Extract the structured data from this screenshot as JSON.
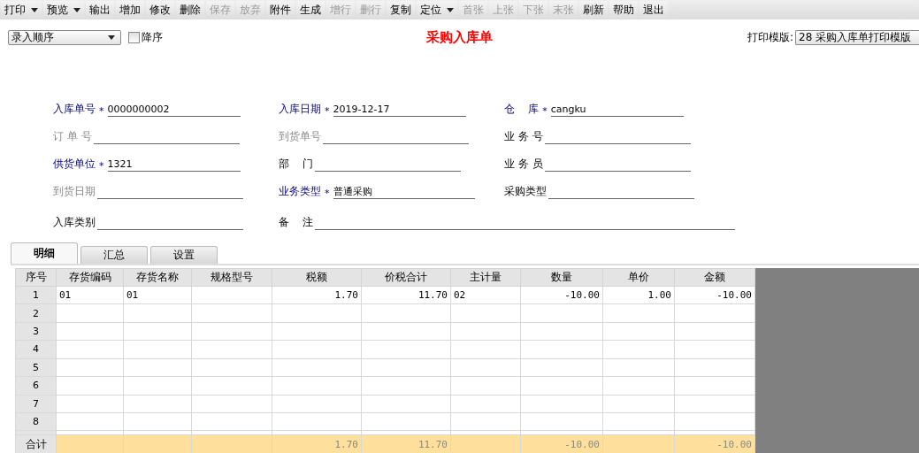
{
  "toolbar": [
    {
      "label": "打印",
      "disabled": false,
      "dropdown": true
    },
    {
      "label": "预览",
      "disabled": false,
      "dropdown": true
    },
    {
      "label": "输出",
      "disabled": false,
      "dropdown": false
    },
    {
      "label": "增加",
      "disabled": false,
      "dropdown": false
    },
    {
      "label": "修改",
      "disabled": false,
      "dropdown": false
    },
    {
      "label": "删除",
      "disabled": false,
      "dropdown": false
    },
    {
      "label": "保存",
      "disabled": true,
      "dropdown": false
    },
    {
      "label": "放弃",
      "disabled": true,
      "dropdown": false
    },
    {
      "label": "附件",
      "disabled": false,
      "dropdown": false
    },
    {
      "label": "生成",
      "disabled": false,
      "dropdown": false
    },
    {
      "label": "增行",
      "disabled": true,
      "dropdown": false
    },
    {
      "label": "删行",
      "disabled": true,
      "dropdown": false
    },
    {
      "label": "复制",
      "disabled": false,
      "dropdown": false
    },
    {
      "label": "定位",
      "disabled": false,
      "dropdown": true
    },
    {
      "label": "首张",
      "disabled": true,
      "dropdown": false
    },
    {
      "label": "上张",
      "disabled": true,
      "dropdown": false
    },
    {
      "label": "下张",
      "disabled": true,
      "dropdown": false
    },
    {
      "label": "末张",
      "disabled": true,
      "dropdown": false
    },
    {
      "label": "刷新",
      "disabled": false,
      "dropdown": false
    },
    {
      "label": "帮助",
      "disabled": false,
      "dropdown": false
    },
    {
      "label": "退出",
      "disabled": false,
      "dropdown": false
    }
  ],
  "sort_select": {
    "value": "录入顺序"
  },
  "descending": {
    "label": "降序",
    "checked": false
  },
  "title": "采购入库单",
  "required_mark": "*",
  "print_template": {
    "label": "打印模版:",
    "value": "28 采购入库单打印模版"
  },
  "form": [
    [
      {
        "label": "入库单号",
        "required": true,
        "disabled": false,
        "value": "0000000002"
      },
      {
        "label": "入库日期",
        "required": true,
        "disabled": false,
        "value": "2019-12-17"
      },
      {
        "label": "仓    库",
        "required": true,
        "disabled": false,
        "value": "cangku"
      }
    ],
    [
      {
        "label": "订 单 号",
        "required": false,
        "disabled": true
      },
      {
        "label": "到货单号",
        "required": false,
        "disabled": true
      },
      {
        "label": "业 务 号",
        "required": false,
        "disabled": false
      }
    ],
    [
      {
        "label": "供货单位",
        "required": true,
        "disabled": false,
        "value": "1321"
      },
      {
        "label": "部    门",
        "required": false,
        "disabled": false
      },
      {
        "label": "业 务 员",
        "required": false,
        "disabled": false
      }
    ],
    [
      {
        "label": "到货日期",
        "required": false,
        "disabled": true
      },
      {
        "label": "业务类型",
        "required": true,
        "disabled": false,
        "value": "普通采购"
      },
      {
        "label": "采购类型",
        "required": false,
        "disabled": false
      }
    ],
    [
      {
        "label": "入库类别",
        "required": false,
        "disabled": false
      },
      {
        "label": "备    注",
        "required": false,
        "disabled": false,
        "kind": "memo"
      }
    ]
  ],
  "tabs": [
    {
      "label": "明细",
      "selected": true
    },
    {
      "label": "汇总",
      "selected": false
    },
    {
      "label": "设置",
      "selected": false
    }
  ],
  "table": {
    "columns": [
      {
        "label": "序号",
        "kind": "index"
      },
      {
        "label": "存货编码",
        "kind": "text"
      },
      {
        "label": "存货名称",
        "kind": "text"
      },
      {
        "label": "规格型号",
        "kind": "text"
      },
      {
        "label": "税额",
        "kind": "number"
      },
      {
        "label": "价税合计",
        "kind": "number"
      },
      {
        "label": "主计量",
        "kind": "text"
      },
      {
        "label": "数量",
        "kind": "number"
      },
      {
        "label": "单价",
        "kind": "number"
      },
      {
        "label": "金额",
        "kind": "number"
      }
    ],
    "rows": [
      {
        "no": "1",
        "cells": [
          "01",
          "01",
          null,
          "1.70",
          "11.70",
          "02",
          "-10.00",
          "1.00",
          "-10.00"
        ]
      },
      {
        "no": "2"
      },
      {
        "no": "3"
      },
      {
        "no": "4"
      },
      {
        "no": "5"
      },
      {
        "no": "6"
      },
      {
        "no": "7"
      },
      {
        "no": "8"
      }
    ],
    "total": {
      "label": "合计",
      "cells": [
        null,
        null,
        null,
        "1.70",
        "11.70",
        null,
        "-10.00",
        null,
        "-10.00"
      ]
    }
  }
}
